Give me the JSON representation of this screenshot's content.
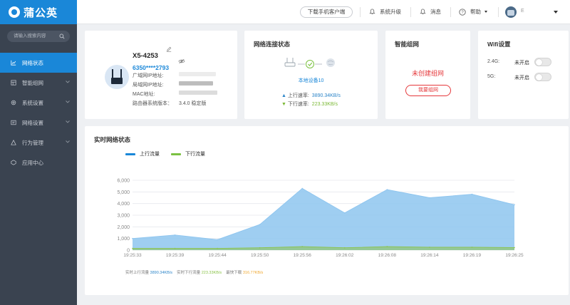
{
  "app": {
    "name": "蒲公英"
  },
  "topbar": {
    "download_btn": "下载手机客户端",
    "upgrade": "系统升级",
    "messages": "消息",
    "help": "帮助",
    "user": "E"
  },
  "sidebar": {
    "search_placeholder": "请输入搜索内容",
    "items": [
      {
        "label": "网络状态",
        "icon": "chart-icon",
        "active": true
      },
      {
        "label": "智能组网",
        "icon": "mesh-icon",
        "active": false
      },
      {
        "label": "系统设置",
        "icon": "gear-icon",
        "active": false
      },
      {
        "label": "网络设置",
        "icon": "network-icon",
        "active": false
      },
      {
        "label": "行为管理",
        "icon": "behavior-icon",
        "active": false
      },
      {
        "label": "应用中心",
        "icon": "apps-icon",
        "active": false
      }
    ]
  },
  "device": {
    "name": "X5-4253",
    "serial": "6350****2793",
    "wan_label": "广域网IP地址:",
    "lan_label": "局域网IP地址:",
    "mac_label": "MAC地址:",
    "fw_label": "路由器系统版本：",
    "fw_value": "3.4.0 稳定版"
  },
  "network": {
    "title": "网络连接状态",
    "device_name": "本地设备10",
    "up_label": "上行速率:",
    "up_value": "3890.34KB/s",
    "down_label": "下行速率:",
    "down_value": "223.33KB/s"
  },
  "mesh": {
    "title": "智能组网",
    "status": "未创建组网",
    "button": "我要组网"
  },
  "wifi": {
    "title": "Wifi设置",
    "band_24": "2.4G:",
    "band_5": "5G:",
    "state_24": "未开启",
    "state_5": "未开启"
  },
  "realtime": {
    "title": "实时网络状态",
    "legend_up": "上行流量",
    "legend_down": "下行流量",
    "foot_up_label": "实时上行流量",
    "foot_up_value": "3890.34KB/s",
    "foot_down_label": "实时下行流量",
    "foot_down_value": "223.33KB/s",
    "foot_max_label": "最快下载",
    "foot_max_value": "316.77KB/s"
  },
  "colors": {
    "brand": "#1a87d8",
    "up": "#2e86c9",
    "down": "#8bc34a",
    "alert": "#e5383b"
  },
  "chart_data": {
    "type": "area",
    "x": [
      "19:25:33",
      "19:25:39",
      "19:25:44",
      "19:25:50",
      "19:25:56",
      "19:26:02",
      "19:26:08",
      "19:26:14",
      "19:26:19",
      "19:26:25"
    ],
    "ylim": [
      0,
      6000
    ],
    "yticks": [
      0,
      1000,
      2000,
      3000,
      4000,
      5000,
      6000
    ],
    "grid": true,
    "legend": "top-left",
    "series": [
      {
        "name": "上行流量",
        "color": "#8ec5ef",
        "values": [
          1000,
          1300,
          900,
          2200,
          5300,
          3200,
          5200,
          4500,
          4800,
          3900
        ]
      },
      {
        "name": "下行流量",
        "color": "#8bc34a",
        "values": [
          150,
          150,
          150,
          200,
          300,
          200,
          300,
          250,
          250,
          220
        ]
      }
    ]
  }
}
